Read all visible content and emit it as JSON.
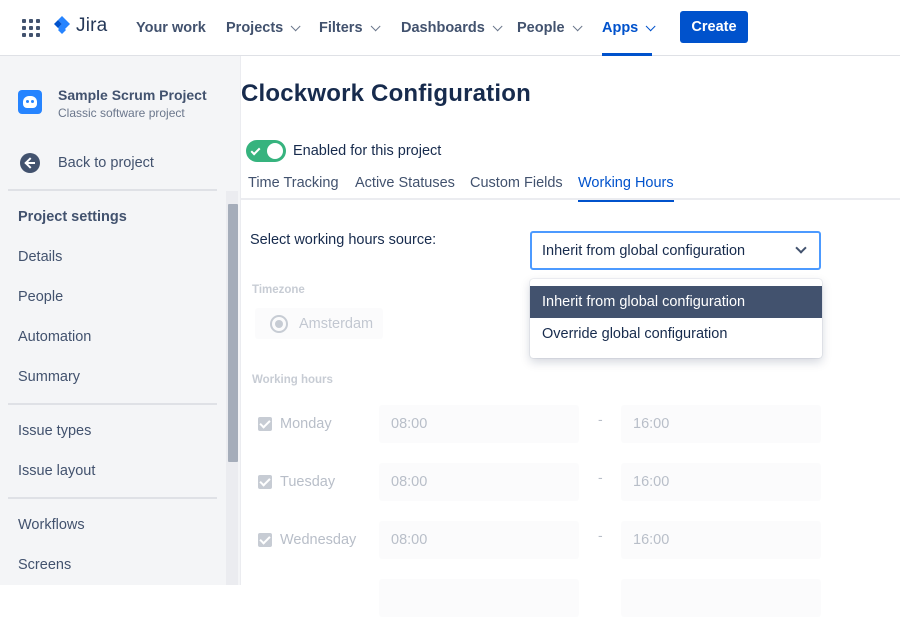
{
  "nav": {
    "logo": "Jira",
    "items": [
      {
        "label": "Your work",
        "dropdown": false
      },
      {
        "label": "Projects",
        "dropdown": true
      },
      {
        "label": "Filters",
        "dropdown": true
      },
      {
        "label": "Dashboards",
        "dropdown": true
      },
      {
        "label": "People",
        "dropdown": true
      },
      {
        "label": "Apps",
        "dropdown": true,
        "active": true
      }
    ],
    "create_label": "Create"
  },
  "sidebar": {
    "project_name": "Sample Scrum Project",
    "project_type": "Classic software project",
    "back_label": "Back to project",
    "heading": "Project settings",
    "group1": [
      "Details",
      "People",
      "Automation",
      "Summary"
    ],
    "group2": [
      "Issue types",
      "Issue layout"
    ],
    "group3": [
      "Workflows",
      "Screens"
    ]
  },
  "main": {
    "title": "Clockwork Configuration",
    "toggle_label": "Enabled for this project",
    "toggle_on": true,
    "tabs": [
      "Time Tracking",
      "Active Statuses",
      "Custom Fields",
      "Working Hours"
    ],
    "active_tab": "Working Hours",
    "source_label": "Select working hours source:",
    "source_value": "Inherit from global configuration",
    "source_options": [
      "Inherit from global configuration",
      "Override global configuration"
    ],
    "timezone_label": "Timezone",
    "timezone_value": "Amsterdam",
    "working_hours_label": "Working hours",
    "days": [
      {
        "name": "Monday",
        "start": "08:00",
        "end": "16:00",
        "checked": true
      },
      {
        "name": "Tuesday",
        "start": "08:00",
        "end": "16:00",
        "checked": true
      },
      {
        "name": "Wednesday",
        "start": "08:00",
        "end": "16:00",
        "checked": true
      }
    ],
    "separator": "-"
  },
  "colors": {
    "accent": "#0052cc",
    "toggle": "#36b37e",
    "selected_option": "#42526e"
  }
}
